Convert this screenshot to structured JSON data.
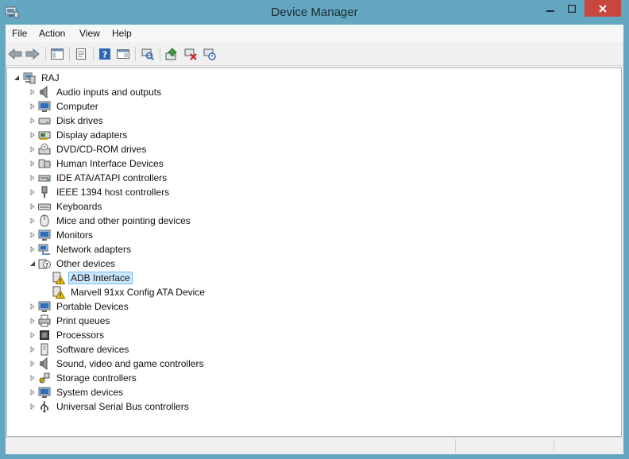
{
  "window": {
    "title": "Device Manager"
  },
  "menu": [
    "File",
    "Action",
    "View",
    "Help"
  ],
  "tree": {
    "root": "RAJ",
    "categories": [
      {
        "label": "Audio inputs and outputs",
        "icon": "speaker-icon"
      },
      {
        "label": "Computer",
        "icon": "monitor-icon"
      },
      {
        "label": "Disk drives",
        "icon": "disk-drive-icon"
      },
      {
        "label": "Display adapters",
        "icon": "display-adapter-icon"
      },
      {
        "label": "DVD/CD-ROM drives",
        "icon": "dvd-drive-icon"
      },
      {
        "label": "Human Interface Devices",
        "icon": "hid-icon"
      },
      {
        "label": "IDE ATA/ATAPI controllers",
        "icon": "ide-controller-icon"
      },
      {
        "label": "IEEE 1394 host controllers",
        "icon": "ieee1394-icon"
      },
      {
        "label": "Keyboards",
        "icon": "keyboard-icon"
      },
      {
        "label": "Mice and other pointing devices",
        "icon": "mouse-icon"
      },
      {
        "label": "Monitors",
        "icon": "monitor-icon"
      },
      {
        "label": "Network adapters",
        "icon": "network-adapter-icon"
      },
      {
        "label": "Other devices",
        "icon": "unknown-device-icon",
        "expanded": true
      },
      {
        "label": "ADB Interface",
        "icon": "warning-device-icon",
        "child": true,
        "selected": true
      },
      {
        "label": "Marvell 91xx Config ATA Device",
        "icon": "warning-device-icon",
        "child": true
      },
      {
        "label": "Portable Devices",
        "icon": "monitor-icon"
      },
      {
        "label": "Print queues",
        "icon": "printer-icon"
      },
      {
        "label": "Processors",
        "icon": "processor-icon"
      },
      {
        "label": "Software devices",
        "icon": "software-device-icon"
      },
      {
        "label": "Sound, video and game controllers",
        "icon": "speaker-icon"
      },
      {
        "label": "Storage controllers",
        "icon": "storage-controller-icon"
      },
      {
        "label": "System devices",
        "icon": "monitor-icon"
      },
      {
        "label": "Universal Serial Bus controllers",
        "icon": "usb-icon"
      }
    ]
  },
  "toolbar": {
    "buttons": [
      "back-icon",
      "forward-icon",
      "show-hide-console-tree-icon",
      "properties-icon",
      "help-icon",
      "action-pane-icon",
      "scan-hardware-icon",
      "update-driver-icon",
      "uninstall-icon",
      "disable-device-icon"
    ]
  },
  "colors": {
    "titlebar": "#63a7c0",
    "close": "#c7463e",
    "selection": "#cce8ff",
    "warning": "#f2c200"
  }
}
